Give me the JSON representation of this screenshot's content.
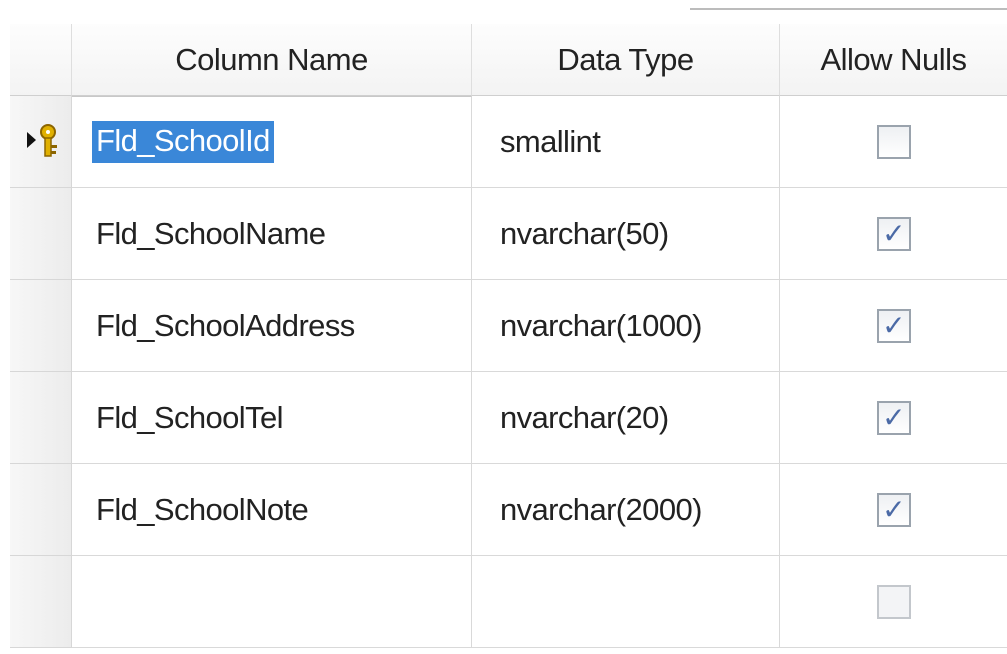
{
  "table_designer": {
    "headers": {
      "column_name": "Column Name",
      "data_type": "Data Type",
      "allow_nulls": "Allow Nulls"
    },
    "rows": [
      {
        "column_name": "Fld_SchoolId",
        "data_type": "smallint",
        "allow_nulls": false,
        "primary_key": true,
        "selected": true
      },
      {
        "column_name": "Fld_SchoolName",
        "data_type": "nvarchar(50)",
        "allow_nulls": true
      },
      {
        "column_name": "Fld_SchoolAddress",
        "data_type": "nvarchar(1000)",
        "allow_nulls": true
      },
      {
        "column_name": "Fld_SchoolTel",
        "data_type": "nvarchar(20)",
        "allow_nulls": true
      },
      {
        "column_name": "Fld_SchoolNote",
        "data_type": "nvarchar(2000)",
        "allow_nulls": true
      },
      {
        "column_name": "",
        "data_type": "",
        "allow_nulls": false,
        "new_row": true
      }
    ],
    "icons": {
      "current_row": "row-arrow-icon",
      "primary_key": "key-icon",
      "checked": "checkmark-icon"
    },
    "colors": {
      "selection": "#3a87d8",
      "key": "#e0b000",
      "check": "#4b6aa6"
    }
  }
}
